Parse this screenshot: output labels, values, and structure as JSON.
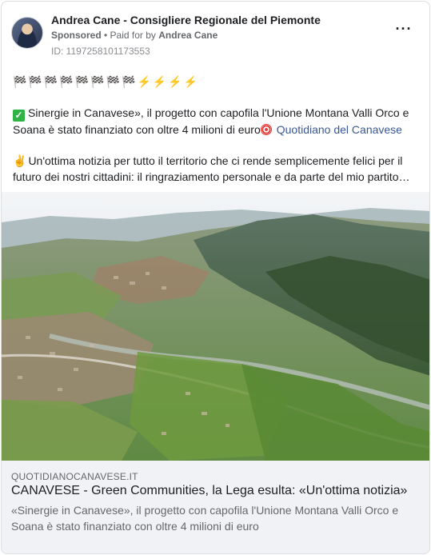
{
  "header": {
    "page_name": "Andrea Cane - Consigliere Regionale del Piemonte",
    "sponsored_label": "Sponsored",
    "separator": " • ",
    "paid_for_label": "Paid for by ",
    "paid_for_name": "Andrea Cane",
    "ad_id": "ID: 1197258101173553",
    "more_label": "···"
  },
  "post": {
    "emoji_line": "🏁🏁🏁🏁🏁🏁🏁🏁⚡⚡⚡⚡",
    "paragraph1_text": "Sinergie in Canavese», il progetto con capofila l'Unione Montana Valli Orco e Soana è stato finanziato con oltre 4 milioni di euro",
    "paragraph1_link": "Quotidiano del Canavese",
    "paragraph2_text": "Un'ottima notizia per tutto il territorio che ci rende semplicemente felici per il futuro dei nostri cittadini: il ringraziamento personale e da parte del mio partito…"
  },
  "link_preview": {
    "domain": "QUOTIDIANOCANAVESE.IT",
    "headline": "CANAVESE - Green Communities, la Lega esulta: «Un'ottima notizia»",
    "description": "«Sinergie in Canavese», il progetto con capofila l'Unione Montana Valli Orco e Soana è stato finanziato con oltre 4 milioni di euro"
  },
  "icons": {
    "avatar": "profile-photo",
    "check": "check-mark-icon",
    "target": "target-icon",
    "hand": "victory-hand-icon",
    "more": "more-options-icon"
  },
  "colors": {
    "link": "#385898",
    "meta_text": "#65676b",
    "footer_bg": "#f0f2f5",
    "check_green": "#2fb344"
  }
}
